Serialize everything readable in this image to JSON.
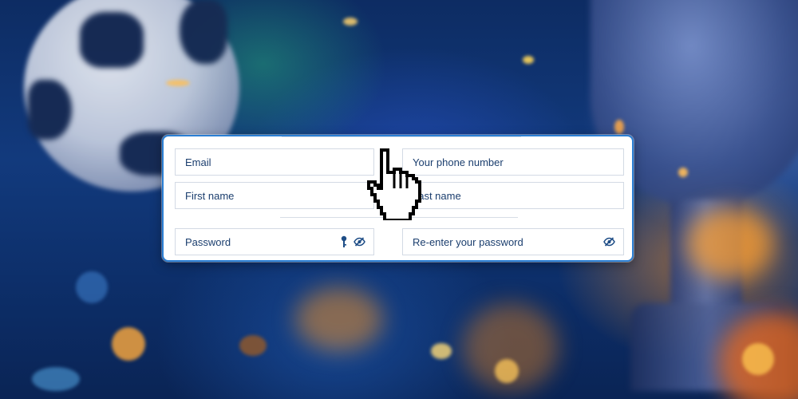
{
  "form": {
    "email_placeholder": "Email",
    "phone_placeholder": "Your phone number",
    "first_name_placeholder": "First name",
    "last_name_placeholder": "Last name",
    "password_placeholder": "Password",
    "reenter_password_placeholder": "Re-enter your password",
    "password_icons": [
      "key-icon",
      "eye-slash-icon"
    ],
    "reenter_password_icons": [
      "eye-slash-icon"
    ]
  },
  "colors": {
    "card_border": "#2b7fd4",
    "field_text": "#1b3e6e",
    "icon": "#1e4d86",
    "background_primary": "#123a7d"
  },
  "cursor": "hand-pointer-icon"
}
